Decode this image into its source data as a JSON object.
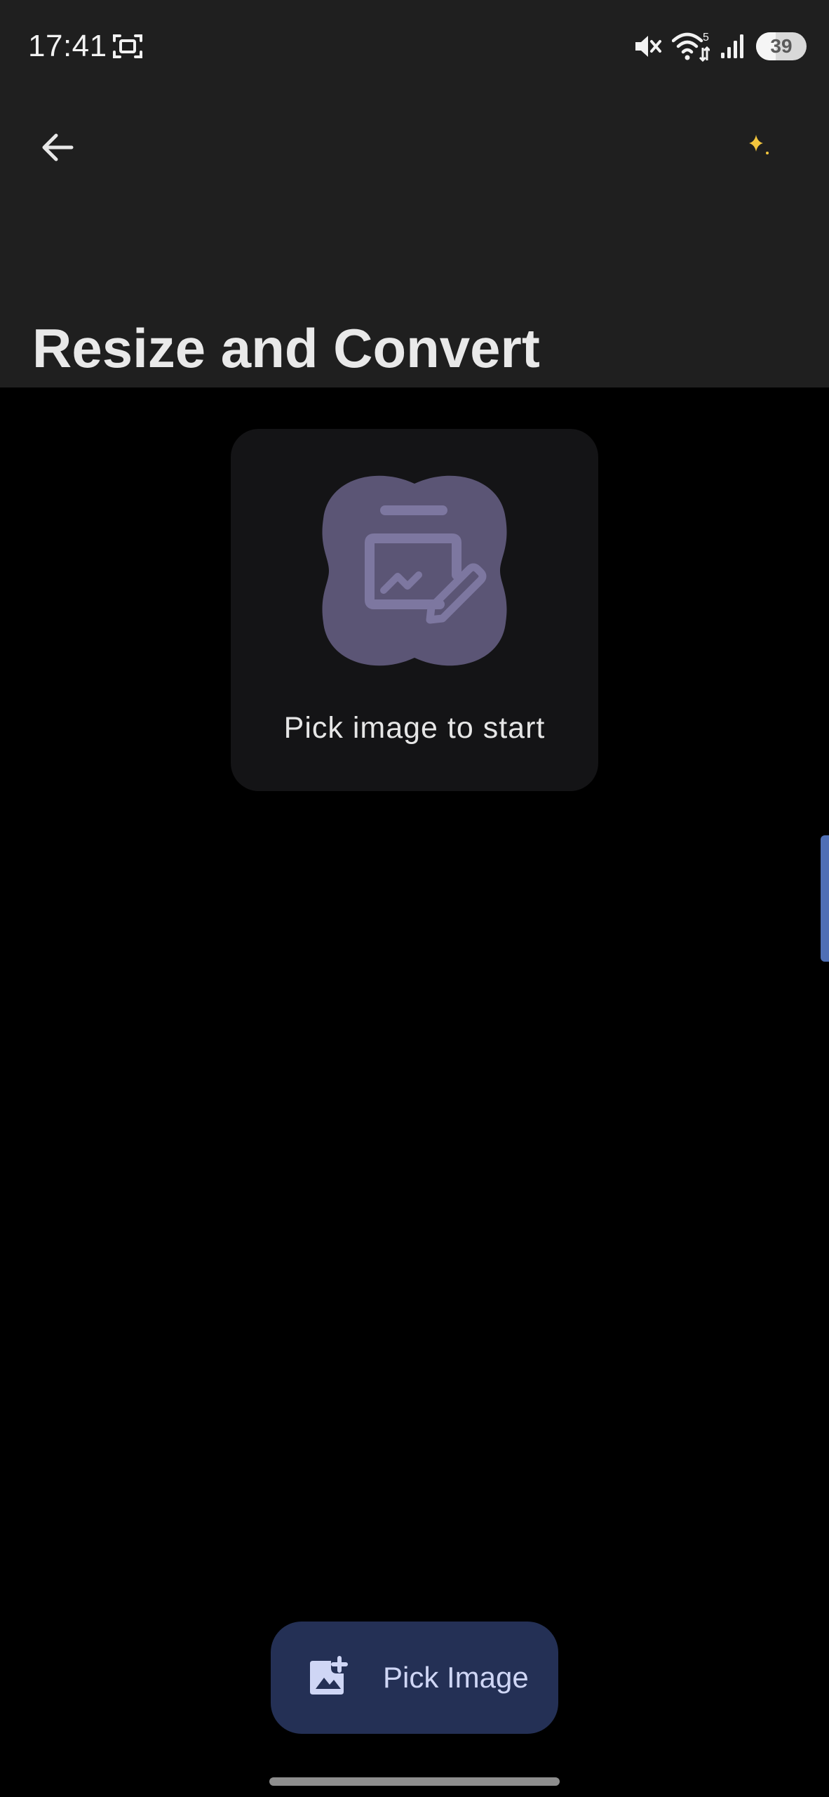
{
  "status_bar": {
    "time": "17:41",
    "left_icon": "screenshot-icon",
    "icons": [
      "mute-icon",
      "wifi-icon",
      "signal-icon"
    ],
    "wifi_badge": "5",
    "battery_level": "39",
    "battery_fraction": 0.39
  },
  "app_bar": {
    "back_icon": "arrow-back-icon",
    "action_icon": "sparkle-icon",
    "title": "Resize and Convert"
  },
  "placeholder": {
    "icon": "image-edit-icon",
    "text": "Pick image to start"
  },
  "fab": {
    "icon": "add-photo-icon",
    "label": "Pick Image"
  },
  "colors": {
    "app_bar_bg": "#1f1f1f",
    "screen_bg": "#000000",
    "card_bg": "#141416",
    "blob": "#5b5575",
    "blob_icon": "#7d77a0",
    "fab_bg": "#243055",
    "fab_text": "#cfd6f5",
    "sparkle": "#f2c53d",
    "scroll_handle": "#4f6fb5"
  }
}
